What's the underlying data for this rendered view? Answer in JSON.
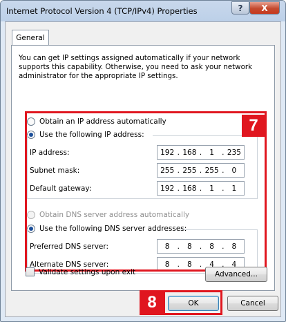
{
  "window": {
    "title": "Internet Protocol Version 4 (TCP/IPv4) Properties",
    "help_label": "?",
    "close_label": "X"
  },
  "tabs": [
    {
      "label": "General"
    }
  ],
  "intro_text": "You can get IP settings assigned automatically if your network supports this capability. Otherwise, you need to ask your network administrator for the appropriate IP settings.",
  "annotations": {
    "badge_7": "7",
    "badge_8": "8",
    "accent_color": "#e0161f"
  },
  "ip": {
    "auto_label": "Obtain an IP address automatically",
    "manual_label": "Use the following IP address:",
    "selected": "manual",
    "fields": [
      {
        "label": "IP address:",
        "octets": [
          "192",
          "168",
          "1",
          "235"
        ]
      },
      {
        "label": "Subnet mask:",
        "octets": [
          "255",
          "255",
          "255",
          "0"
        ]
      },
      {
        "label": "Default gateway:",
        "octets": [
          "192",
          "168",
          "1",
          "1"
        ]
      }
    ]
  },
  "dns": {
    "auto_label": "Obtain DNS server address automatically",
    "manual_label": "Use the following DNS server addresses:",
    "selected": "manual",
    "fields": [
      {
        "label": "Preferred DNS server:",
        "octets": [
          "8",
          "8",
          "8",
          "8"
        ]
      },
      {
        "label": "Alternate DNS server:",
        "octets": [
          "8",
          "8",
          "4",
          "4"
        ]
      }
    ]
  },
  "validate": {
    "label": "Validate settings upon exit",
    "checked": false
  },
  "buttons": {
    "advanced": "Advanced...",
    "ok": "OK",
    "cancel": "Cancel"
  }
}
